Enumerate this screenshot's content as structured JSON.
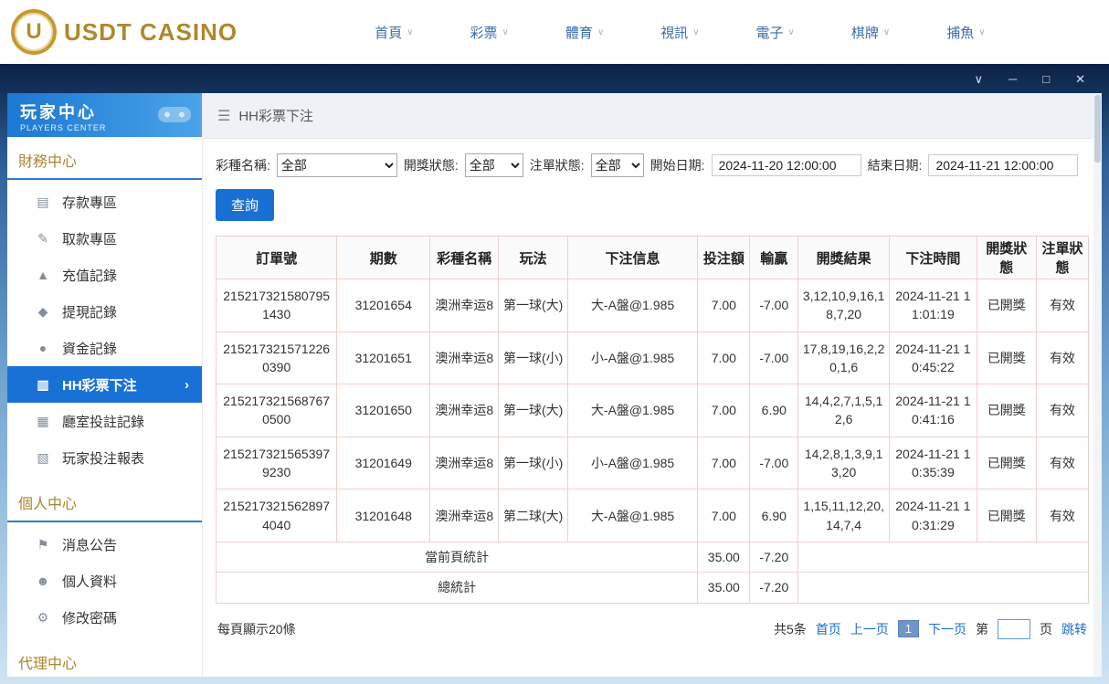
{
  "topbar": {
    "brand": "USDT CASINO",
    "caret": "∨",
    "nav": [
      {
        "label": "首頁"
      },
      {
        "label": "彩票"
      },
      {
        "label": "體育"
      },
      {
        "label": "視訊"
      },
      {
        "label": "電子"
      },
      {
        "label": "棋牌"
      },
      {
        "label": "捕魚"
      }
    ]
  },
  "window": {
    "controls": {
      "collapse": "∨",
      "minimize": "─",
      "maximize": "□",
      "close": "✕"
    }
  },
  "sidebar": {
    "title": "玩家中心",
    "subtitle": "PLAYERS CENTER",
    "sections": [
      {
        "title": "財務中心",
        "items": [
          {
            "icon": "▤",
            "label": "存款專區"
          },
          {
            "icon": "✎",
            "label": "取款專區"
          },
          {
            "icon": "▲",
            "label": "充值記錄"
          },
          {
            "icon": "◆",
            "label": "提現記錄"
          },
          {
            "icon": "●",
            "label": "資金記錄"
          },
          {
            "icon": "▥",
            "label": "HH彩票下注",
            "chevron": "›"
          },
          {
            "icon": "▦",
            "label": "廳室投註記錄"
          },
          {
            "icon": "▧",
            "label": "玩家投注報表"
          }
        ]
      },
      {
        "title": "個人中心",
        "items": [
          {
            "icon": "⚑",
            "label": "消息公告"
          },
          {
            "icon": "☻",
            "label": "個人資料"
          },
          {
            "icon": "⚙",
            "label": "修改密碼"
          }
        ]
      },
      {
        "title": "代理中心",
        "items": []
      }
    ]
  },
  "main": {
    "breadcrumb": {
      "icon": "☰",
      "label": "HH彩票下注"
    },
    "filters": {
      "lottery_label": "彩種名稱:",
      "lottery_value": "全部",
      "draw_label": "開獎狀態:",
      "draw_value": "全部",
      "order_label": "注單狀態:",
      "order_value": "全部",
      "start_label": "開始日期:",
      "start_value": "2024-11-20 12:00:00",
      "end_label": "結束日期:",
      "end_value": "2024-11-21 12:00:00",
      "search": "查詢"
    },
    "table": {
      "headers": [
        "訂單號",
        "期數",
        "彩種名稱",
        "玩法",
        "下注信息",
        "投注額",
        "輸贏",
        "開獎結果",
        "下注時間",
        "開獎狀態",
        "注單狀態"
      ],
      "rows": [
        [
          "2152173215807951430",
          "31201654",
          "澳洲幸运8",
          "第一球(大)",
          "大-A盤@1.985",
          "7.00",
          "-7.00",
          "3,12,10,9,16,18,7,20",
          "2024-11-21 11:01:19",
          "已開獎",
          "有效"
        ],
        [
          "2152173215712260390",
          "31201651",
          "澳洲幸运8",
          "第一球(小)",
          "小-A盤@1.985",
          "7.00",
          "-7.00",
          "17,8,19,16,2,20,1,6",
          "2024-11-21 10:45:22",
          "已開獎",
          "有效"
        ],
        [
          "2152173215687670500",
          "31201650",
          "澳洲幸运8",
          "第一球(大)",
          "大-A盤@1.985",
          "7.00",
          "6.90",
          "14,4,2,7,1,5,12,6",
          "2024-11-21 10:41:16",
          "已開獎",
          "有效"
        ],
        [
          "2152173215653979230",
          "31201649",
          "澳洲幸运8",
          "第一球(小)",
          "小-A盤@1.985",
          "7.00",
          "-7.00",
          "14,2,8,1,3,9,13,20",
          "2024-11-21 10:35:39",
          "已開獎",
          "有效"
        ],
        [
          "2152173215628974040",
          "31201648",
          "澳洲幸运8",
          "第二球(大)",
          "大-A盤@1.985",
          "7.00",
          "6.90",
          "1,15,11,12,20,14,7,4",
          "2024-11-21 10:31:29",
          "已開獎",
          "有效"
        ]
      ],
      "page_summary": {
        "label": "當前頁統計",
        "bet": "35.00",
        "winloss": "-7.20"
      },
      "total_summary": {
        "label": "總統計",
        "bet": "35.00",
        "winloss": "-7.20"
      }
    },
    "footer": {
      "page_size": "每頁顯示20條",
      "total": "共5条",
      "first": "首页",
      "prev": "上一页",
      "current": "1",
      "next": "下一页",
      "jump_before": "第",
      "jump_after": "页",
      "jump": "跳转"
    }
  }
}
